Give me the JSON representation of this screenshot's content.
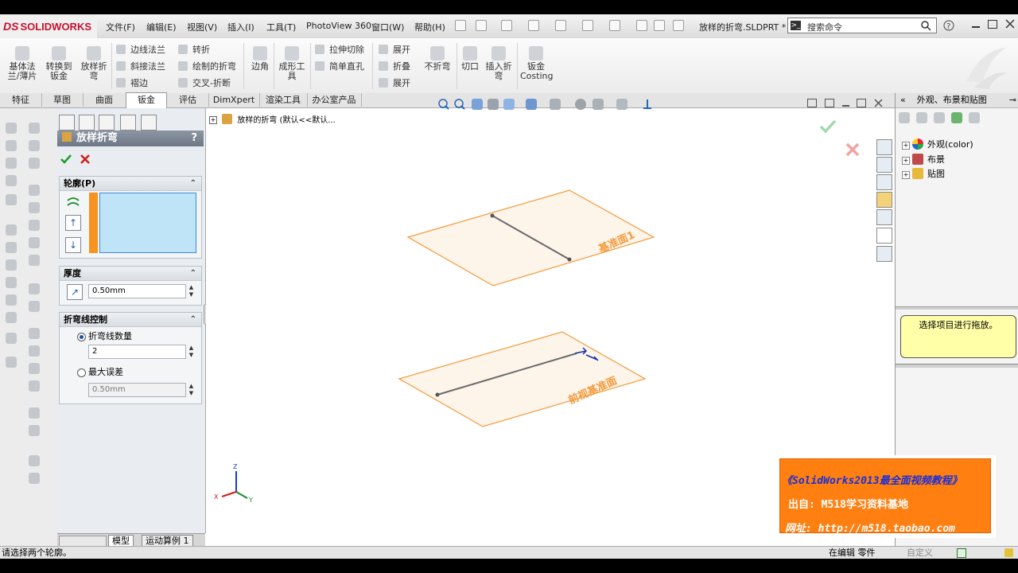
{
  "app": {
    "logo": "SOLIDWORKS",
    "logo_prefix": "DS",
    "doc_title": "放样的折弯.SLDPRT *"
  },
  "menu": [
    "文件(F)",
    "编辑(E)",
    "视图(V)",
    "插入(I)",
    "工具(T)",
    "PhotoView 360",
    "窗口(W)",
    "帮助(H)"
  ],
  "search": {
    "placeholder": "搜索命令"
  },
  "ribbon": {
    "big": [
      {
        "label1": "基体法",
        "label2": "兰/薄片"
      },
      {
        "label1": "转换到",
        "label2": "钣金"
      },
      {
        "label1": "放样折",
        "label2": "弯"
      }
    ],
    "small_col1": [
      "边线法兰",
      "斜接法兰",
      "褶边"
    ],
    "small_col2": [
      "转折",
      "绘制的折弯",
      "交叉-折断"
    ],
    "corner": "边角",
    "forming": {
      "label1": "成形工",
      "label2": "具"
    },
    "small_col3": [
      "拉伸切除",
      "简单直孔"
    ],
    "small_col4": [
      "展开",
      "折叠",
      "展开"
    ],
    "nofold": "不折弯",
    "cut": "切口",
    "insertbend": {
      "label1": "插入折",
      "label2": "弯"
    },
    "costing": {
      "label1": "钣金",
      "label2": "Costing"
    }
  },
  "tabs": [
    "特征",
    "草图",
    "曲面",
    "钣金",
    "评估",
    "DimXpert",
    "渲染工具",
    "办公室产品"
  ],
  "pm": {
    "title": "放样折弯",
    "help": "?",
    "profile_group": "轮廓(P)",
    "thickness_group": "厚度",
    "thickness_value": "0.50mm",
    "bendline_group": "折弯线控制",
    "radio1": "折弯线数量",
    "radio1_value": "2",
    "radio2": "最大误差",
    "radio2_value": "0.50mm"
  },
  "bottom_tabs": [
    "模型",
    "运动算例 1"
  ],
  "graphics": {
    "tree_root": "放样的折弯  (默认<<默认...",
    "plane_top_label": "基准面1",
    "plane_bottom_label": "前视基准面",
    "triad": {
      "x": "X",
      "y": "Y",
      "z": "Z"
    }
  },
  "right_panel": {
    "title": "外观、布景和贴图",
    "nodes": [
      "外观(color)",
      "布景",
      "贴图"
    ],
    "hint": "选择项目进行拖放。"
  },
  "ad": {
    "line1": "《SolidWorks2013最全面视频教程》",
    "line2": "出自: M518学习资料基地",
    "line3_label": "网址:",
    "line3_url": "http://m518.taobao.com"
  },
  "status": {
    "left": "请选择两个轮廓。",
    "mode": "在编辑 零件",
    "custom": "自定义"
  },
  "colors": {
    "accent_orange": "#ff7f11",
    "plane_orange": "#f39a3a",
    "pm_header": "#7a8391",
    "hint_yellow": "#ffffa8"
  }
}
